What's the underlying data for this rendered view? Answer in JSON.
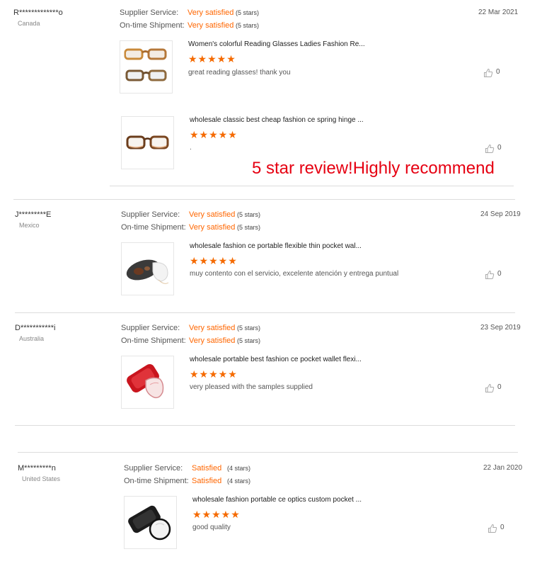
{
  "labels": {
    "supplier_service": "Supplier Service:",
    "ontime_shipment": "On-time Shipment:"
  },
  "colors": {
    "accent": "#ff6600",
    "star": "#f56a00",
    "overlay": "#e60012"
  },
  "reviews": [
    {
      "name": "R*************o",
      "country": "Canada",
      "supplier_service": "Very satisfied",
      "supplier_stars": "(5 stars)",
      "ontime_shipment": "Very satisfied",
      "ontime_stars": "(5 stars)",
      "date": "22 Mar 2021",
      "products": [
        {
          "title": "Women's colorful Reading Glasses Ladies Fashion Re...",
          "stars": "★★★★★",
          "rating": 5,
          "feedback": "great reading glasses! thank you",
          "likes": "0",
          "thumb_icon": "reading-glasses-pair-icon"
        },
        {
          "title": "wholesale classic best cheap fashion ce spring hinge ...",
          "stars": "★★★★★",
          "rating": 5,
          "feedback": ".",
          "likes": "0",
          "thumb_icon": "tortoise-glasses-icon"
        }
      ]
    },
    {
      "name": "J*********E",
      "country": "Mexico",
      "supplier_service": "Very satisfied",
      "supplier_stars": "(5 stars)",
      "ontime_shipment": "Very satisfied",
      "ontime_stars": "(5 stars)",
      "date": "24 Sep 2019",
      "products": [
        {
          "title": "wholesale fashion ce portable flexible thin pocket wal...",
          "stars": "★★★★★",
          "rating": 5,
          "feedback": "muy contento con el servicio, excelente atención y entrega puntual",
          "likes": "0",
          "thumb_icon": "pocket-glasses-clip-icon"
        }
      ]
    },
    {
      "name": "D***********i",
      "country": "Australia",
      "supplier_service": "Very satisfied",
      "supplier_stars": "(5 stars)",
      "ontime_shipment": "Very satisfied",
      "ontime_stars": "(5 stars)",
      "date": "23 Sep 2019",
      "products": [
        {
          "title": "wholesale portable best fashion ce pocket wallet flexi...",
          "stars": "★★★★★",
          "rating": 5,
          "feedback": "very pleased with the samples supplied",
          "likes": "0",
          "thumb_icon": "red-pocket-glasses-icon"
        }
      ]
    },
    {
      "name": "M*********n",
      "country": "United States",
      "supplier_service": "Satisfied",
      "supplier_stars": "(4 stars)",
      "ontime_shipment": "Satisfied",
      "ontime_stars": "(4 stars)",
      "date": "22 Jan 2020",
      "products": [
        {
          "title": "wholesale fashion portable ce optics custom pocket ...",
          "stars": "★★★★★",
          "rating": 5,
          "feedback": "good quality",
          "likes": "0",
          "thumb_icon": "black-pocket-glasses-icon"
        }
      ]
    }
  ],
  "overlay_text": "5 star review!Highly recommend"
}
